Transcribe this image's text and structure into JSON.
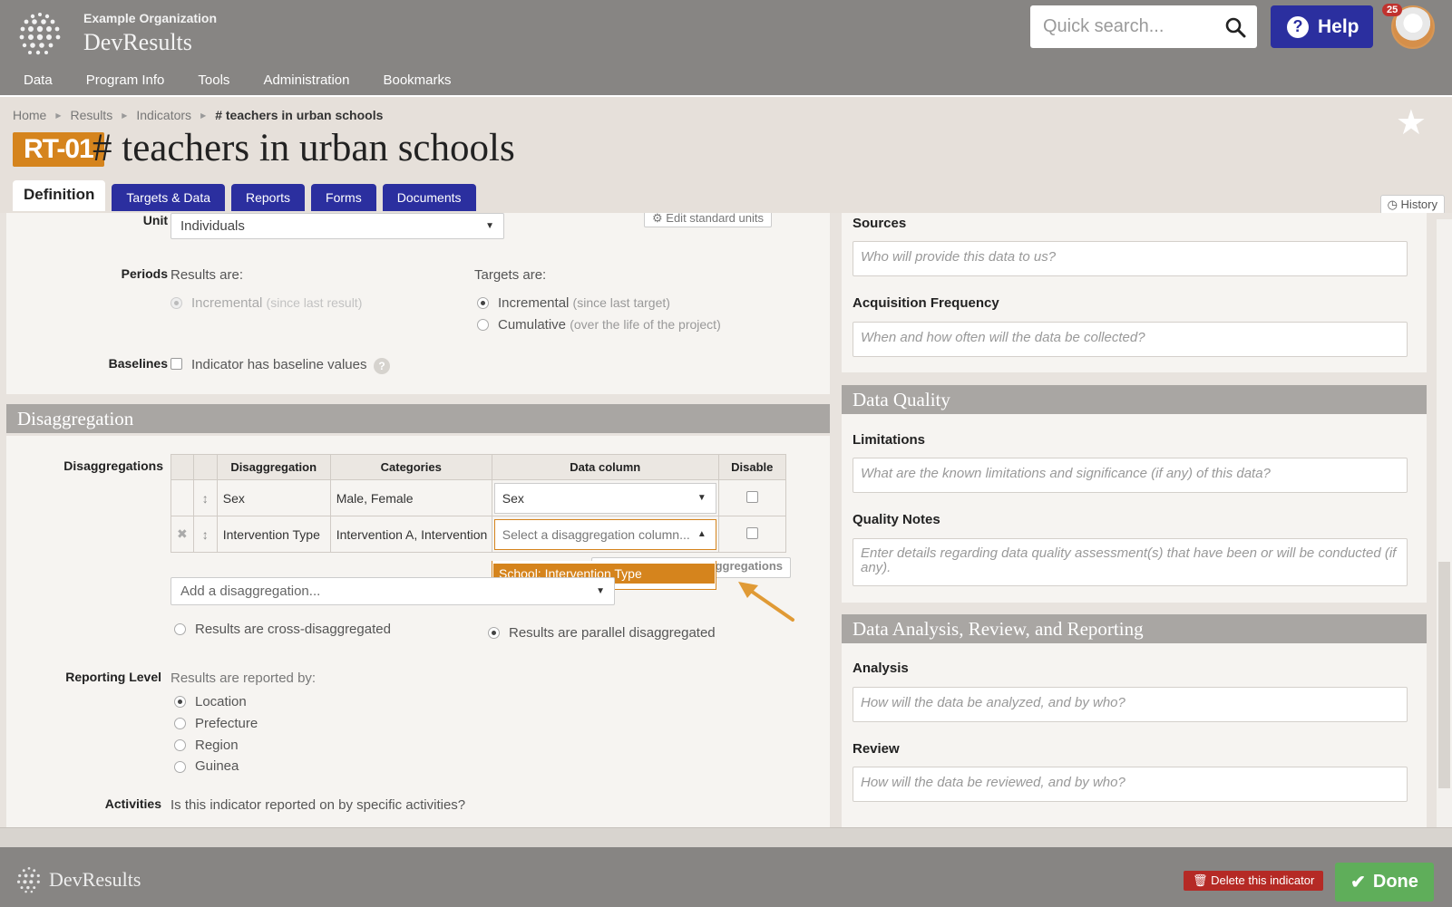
{
  "header": {
    "org_name": "Example Organization",
    "app_name": "DevResults",
    "search_placeholder": "Quick search...",
    "help_label": "Help",
    "notification_count": "25",
    "nav": [
      "Data",
      "Program Info",
      "Tools",
      "Administration",
      "Bookmarks"
    ]
  },
  "breadcrumb": [
    "Home",
    "Results",
    "Indicators",
    "# teachers in urban schools"
  ],
  "indicator": {
    "code": "RT-01",
    "title": "# teachers in urban schools"
  },
  "tabs": [
    "Definition",
    "Targets & Data",
    "Reports",
    "Forms",
    "Documents"
  ],
  "history_label": "History",
  "unit": {
    "label": "Unit",
    "value": "Individuals",
    "edit_label": "Edit standard units"
  },
  "periods": {
    "label": "Periods",
    "results_heading": "Results are:",
    "results_option": "Incremental",
    "results_option_hint": "(since last result)",
    "targets_heading": "Targets are:",
    "targets_options": [
      {
        "label": "Incremental",
        "hint": "(since last target)",
        "selected": true
      },
      {
        "label": "Cumulative",
        "hint": "(over the life of the project)",
        "selected": false
      }
    ]
  },
  "baselines": {
    "label": "Baselines",
    "checkbox_label": "Indicator has baseline values",
    "help": "?"
  },
  "disaggregation": {
    "section_title": "Disaggregation",
    "label": "Disaggregations",
    "columns": [
      "Disaggregation",
      "Categories",
      "Data column",
      "Disable"
    ],
    "rows": [
      {
        "name": "Sex",
        "categories": "Male, Female",
        "data_column": "Sex"
      },
      {
        "name": "Intervention Type",
        "categories": "Intervention A, Intervention B",
        "data_column": "Select a disaggregation column..."
      }
    ],
    "dropdown_option": "School: Intervention Type",
    "manage_label": "ggregations",
    "add_placeholder": "Add a disaggregation...",
    "cross_label": "Results are cross-disaggregated",
    "parallel_label": "Results are parallel disaggregated"
  },
  "reporting_level": {
    "label": "Reporting Level",
    "heading": "Results are reported by:",
    "options": [
      "Location",
      "Prefecture",
      "Region",
      "Guinea"
    ]
  },
  "activities": {
    "label": "Activities",
    "question": "Is this indicator reported on by specific activities?"
  },
  "right": {
    "sources_label": "Sources",
    "sources_placeholder": "Who will provide this data to us?",
    "acq_label": "Acquisition Frequency",
    "acq_placeholder": "When and how often will the data be collected?",
    "quality_title": "Data Quality",
    "limitations_label": "Limitations",
    "limitations_placeholder": "What are the known limitations and significance (if any) of this data?",
    "quality_notes_label": "Quality Notes",
    "quality_notes_placeholder": "Enter details regarding data quality assessment(s) that have been or will be conducted (if any).",
    "analysis_title": "Data Analysis, Review, and Reporting",
    "analysis_label": "Analysis",
    "analysis_placeholder": "How will the data be analyzed, and by who?",
    "review_label": "Review",
    "review_placeholder": "How will the data be reviewed, and by who?"
  },
  "footer": {
    "logo_text": "DevResults",
    "delete_label": "Delete this indicator",
    "done_label": "Done"
  },
  "colors": {
    "brand_blue": "#2b2f9f",
    "accent_orange": "#d5841d",
    "header_gray": "#878583",
    "done_green": "#5fae5a",
    "delete_red": "#b52a25"
  }
}
